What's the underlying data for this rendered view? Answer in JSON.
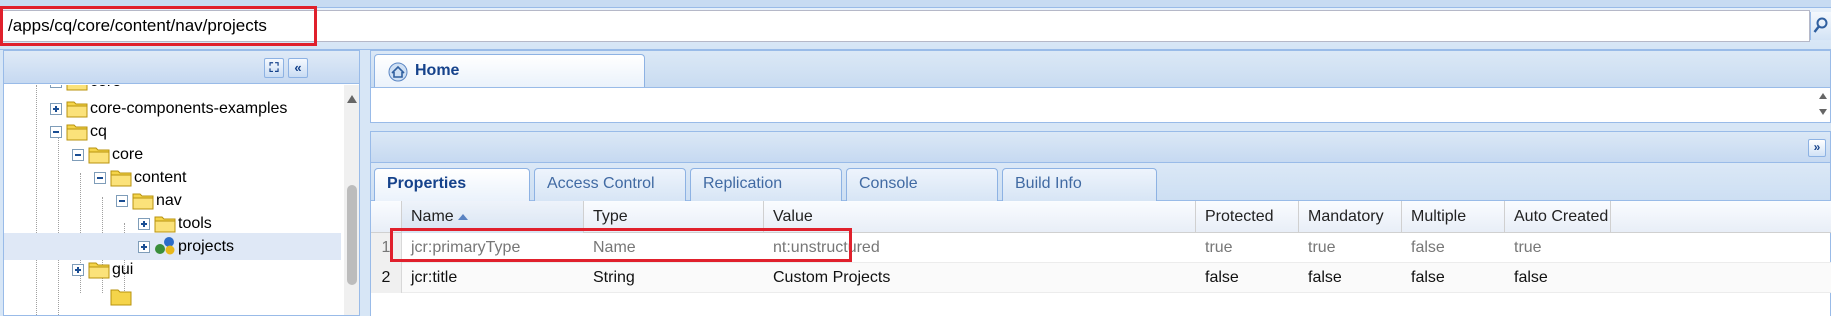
{
  "path_bar": {
    "value": "/apps/cq/core/content/nav/projects"
  },
  "tree": {
    "items": [
      {
        "label": "core",
        "expander": "minus"
      },
      {
        "label": "core-components-examples",
        "expander": "plus"
      },
      {
        "label": "cq",
        "expander": "minus"
      },
      {
        "label": "core",
        "expander": "minus"
      },
      {
        "label": "content",
        "expander": "minus"
      },
      {
        "label": "nav",
        "expander": "minus"
      },
      {
        "label": "tools",
        "expander": "plus"
      },
      {
        "label": "projects",
        "expander": "plus",
        "selected": true
      },
      {
        "label": "gui",
        "expander": "plus"
      }
    ]
  },
  "home_tab": {
    "label": "Home"
  },
  "property_tabs": [
    "Properties",
    "Access Control",
    "Replication",
    "Console",
    "Build Info"
  ],
  "grid": {
    "columns": [
      "Name",
      "Type",
      "Value",
      "Protected",
      "Mandatory",
      "Multiple",
      "Auto Created"
    ],
    "rows": [
      {
        "num": "1",
        "name": "jcr:primaryType",
        "type": "Name",
        "value": "nt:unstructured",
        "protected": "true",
        "mandatory": "true",
        "multiple": "false",
        "auto_created": "true"
      },
      {
        "num": "2",
        "name": "jcr:title",
        "type": "String",
        "value": "Custom Projects",
        "protected": "false",
        "mandatory": "false",
        "multiple": "false",
        "auto_created": "false"
      }
    ]
  },
  "colors": {
    "accent": "#15428b",
    "highlight": "#e0202c",
    "panel": "#d7e6f6"
  }
}
